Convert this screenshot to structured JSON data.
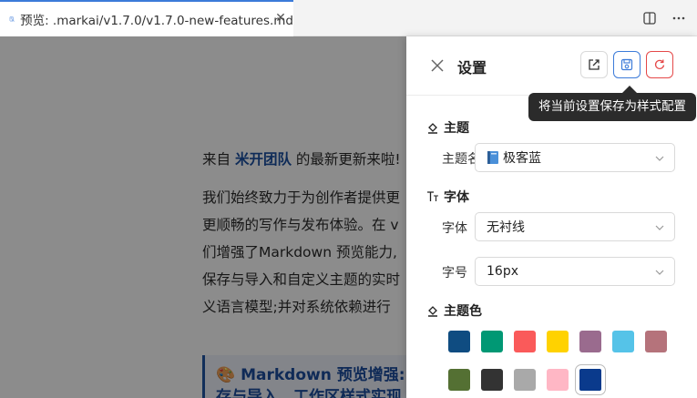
{
  "tab": {
    "title": "预览: .markai/v1.7.0/v1.7.0-new-features.md",
    "close": "✕"
  },
  "tabbar_actions": [
    "split-editor-icon",
    "more-actions-icon"
  ],
  "preview": {
    "line1_pre": "来自 ",
    "line1_brand": "米开团队",
    "line1_post": " 的最新更新来啦!",
    "paragraph_lines": [
      "我们始终致力于为创作者提供更",
      "更顺畅的写作与发布体验。在 v",
      "们增强了Markdown 预览能力,",
      "保存与导入和自定义主题的实时",
      "义语言模型;并对系统依赖进行"
    ],
    "callout_emoji": "🎨",
    "callout_title": "Markdown 预览增强:",
    "callout_sub": "存与导入、工作区样式实现"
  },
  "settings": {
    "title": "设置",
    "tooltip": "将当前设置保存为样式配置",
    "buttons": [
      "export-icon",
      "save-style-icon",
      "reset-icon"
    ],
    "theme": {
      "section": "主题",
      "name_label": "主题名称",
      "name_value": "极客蓝"
    },
    "font": {
      "section": "字体",
      "family_label": "字体",
      "family_value": "无衬线",
      "size_label": "字号",
      "size_value": "16px"
    },
    "theme_color": {
      "section": "主题色",
      "swatches": [
        "#0f4c81",
        "#009874",
        "#fa5a5a",
        "#ffd200",
        "#9a6b8e",
        "#55c3e8",
        "#b5737b",
        "#547033",
        "#333333",
        "#a9a9a9",
        "#ffb7c5",
        "#0a3a8c"
      ],
      "selected": "#0a3a8c"
    }
  }
}
